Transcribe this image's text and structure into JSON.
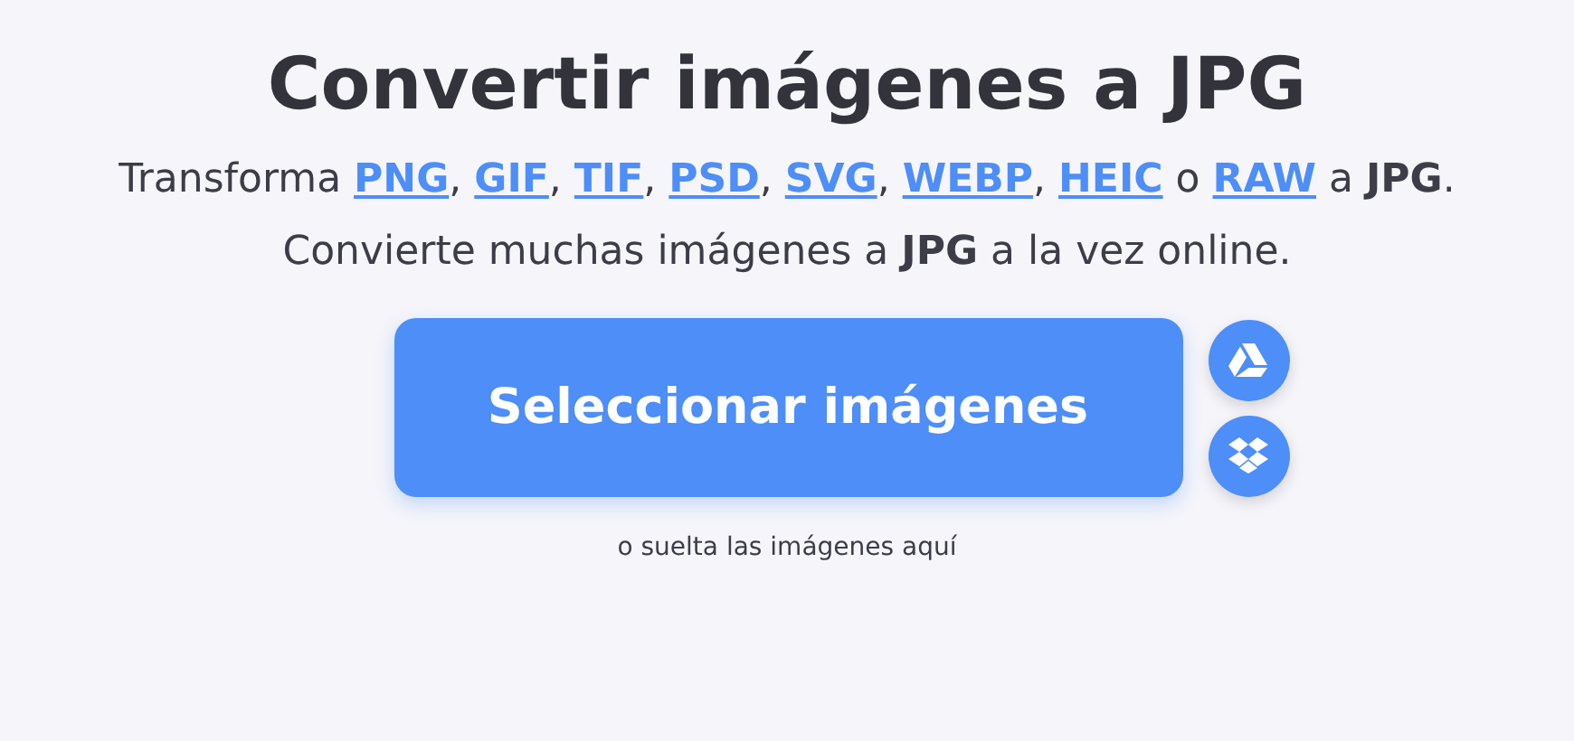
{
  "title": "Convertir imágenes a JPG",
  "subtitle_lines": [
    [
      {
        "kind": "text",
        "text": "Transforma "
      },
      {
        "kind": "link",
        "text": "PNG"
      },
      {
        "kind": "text",
        "text": ", "
      },
      {
        "kind": "link",
        "text": "GIF"
      },
      {
        "kind": "text",
        "text": ", "
      },
      {
        "kind": "link",
        "text": "TIF"
      },
      {
        "kind": "text",
        "text": ", "
      },
      {
        "kind": "link",
        "text": "PSD"
      },
      {
        "kind": "text",
        "text": ", "
      },
      {
        "kind": "link",
        "text": "SVG"
      },
      {
        "kind": "text",
        "text": ", "
      },
      {
        "kind": "link",
        "text": "WEBP"
      },
      {
        "kind": "text",
        "text": ", "
      },
      {
        "kind": "link",
        "text": "HEIC"
      },
      {
        "kind": "text",
        "text": " o "
      },
      {
        "kind": "link",
        "text": "RAW"
      },
      {
        "kind": "text",
        "text": " a **JPG**."
      }
    ],
    [
      {
        "kind": "text",
        "text": "Convierte muchas imágenes a **JPG** a la vez online."
      }
    ]
  ],
  "upload_button": "Seleccionar imágenes",
  "cloud_buttons": [
    {
      "kind": "drive"
    },
    {
      "kind": "dropbox"
    }
  ],
  "drop_hint": "o suelta las imágenes aquí"
}
